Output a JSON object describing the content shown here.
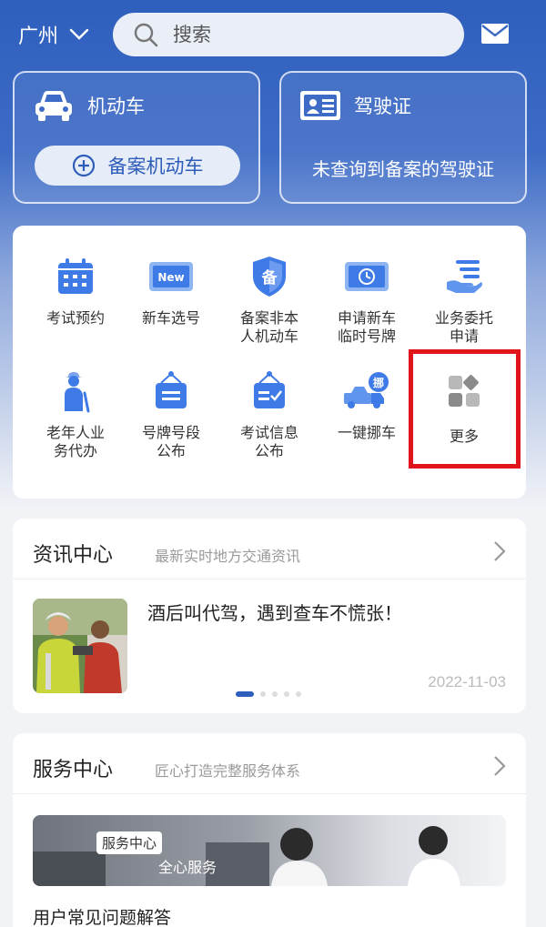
{
  "header": {
    "city": "广州",
    "search_placeholder": "搜索"
  },
  "cards": {
    "vehicle": {
      "title": "机动车",
      "button": "备案机动车"
    },
    "license": {
      "title": "驾驶证",
      "note": "未查询到备案的驾驶证"
    }
  },
  "services": [
    {
      "label1": "考试预约",
      "label2": "",
      "icon": "calendar-icon"
    },
    {
      "label1": "新车选号",
      "label2": "",
      "icon": "new-plate-icon"
    },
    {
      "label1": "备案非本",
      "label2": "人机动车",
      "icon": "shield-icon"
    },
    {
      "label1": "申请新车",
      "label2": "临时号牌",
      "icon": "temp-plate-icon"
    },
    {
      "label1": "业务委托",
      "label2": "申请",
      "icon": "hand-list-icon"
    },
    {
      "label1": "老年人业",
      "label2": "务代办",
      "icon": "elderly-icon"
    },
    {
      "label1": "号牌号段",
      "label2": "公布",
      "icon": "clipboard-icon"
    },
    {
      "label1": "考试信息",
      "label2": "公布",
      "icon": "clipboard-check-icon"
    },
    {
      "label1": "一键挪车",
      "label2": "",
      "icon": "truck-icon"
    },
    {
      "label1": "更多",
      "label2": "",
      "icon": "more-grid-icon"
    }
  ],
  "news": {
    "title": "资讯中心",
    "subtitle": "最新实时地方交通资讯",
    "headline": "酒后叫代驾，遇到查车不慌张！",
    "date": "2022-11-03"
  },
  "service_center": {
    "title": "服务中心",
    "subtitle": "匠心打造完整服务体系",
    "banner_tag": "服务中心",
    "banner_text": "全心服务",
    "faq": "用户常见问题解答"
  },
  "colors": {
    "primary": "#2f5fbd",
    "highlight": "#e1141c"
  }
}
